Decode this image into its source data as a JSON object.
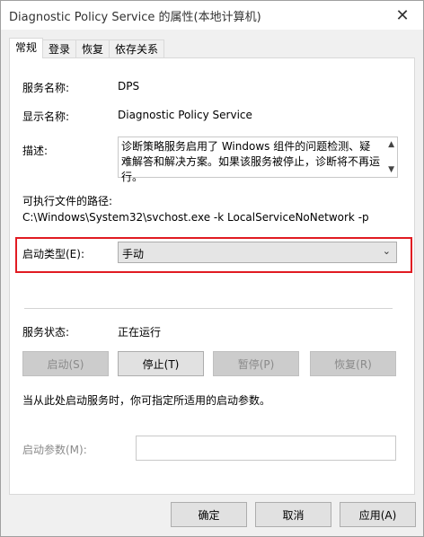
{
  "window": {
    "title": "Diagnostic Policy Service 的属性(本地计算机)",
    "close_glyph": "✕"
  },
  "tabs": [
    {
      "label": "常规",
      "active": true
    },
    {
      "label": "登录",
      "active": false
    },
    {
      "label": "恢复",
      "active": false
    },
    {
      "label": "依存关系",
      "active": false
    }
  ],
  "general": {
    "service_name_label": "服务名称:",
    "service_name": "DPS",
    "display_name_label": "显示名称:",
    "display_name": "Diagnostic Policy Service",
    "description_label": "描述:",
    "description": "诊断策略服务启用了 Windows 组件的问题检测、疑难解答和解决方案。如果该服务被停止，诊断将不再运行。",
    "exe_path_label": "可执行文件的路径:",
    "exe_path": "C:\\Windows\\System32\\svchost.exe -k LocalServiceNoNetwork -p",
    "startup_type_label": "启动类型(E):",
    "startup_type_value": "手动",
    "service_status_label": "服务状态:",
    "service_status": "正在运行",
    "buttons": {
      "start": "启动(S)",
      "stop": "停止(T)",
      "pause": "暂停(P)",
      "resume": "恢复(R)"
    },
    "hint": "当从此处启动服务时，你可指定所适用的启动参数。",
    "start_params_label": "启动参数(M):",
    "start_params_value": ""
  },
  "footer": {
    "ok": "确定",
    "cancel": "取消",
    "apply": "应用(A)"
  },
  "colors": {
    "highlight_border": "#e11b22",
    "panel_bg": "#ffffff",
    "window_bg": "#f0f0f0"
  }
}
